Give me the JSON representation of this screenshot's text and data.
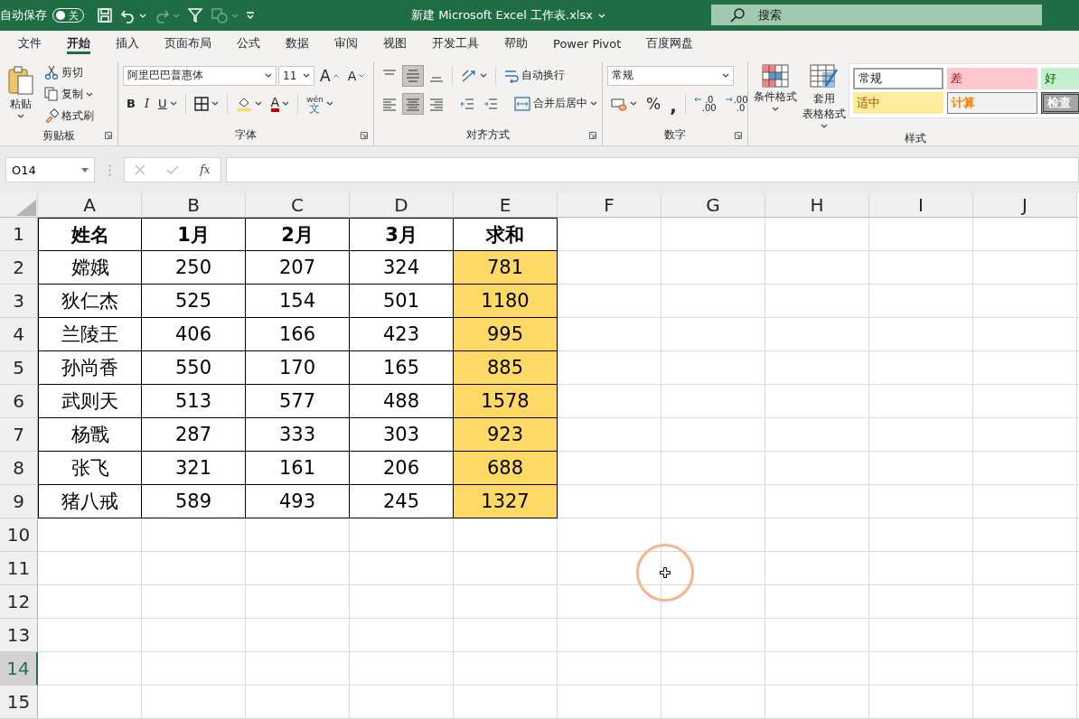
{
  "title_bar": {
    "autosave_label": "自动保存",
    "autosave_toggle": {
      "label": "关",
      "on": false
    },
    "quick_access": [
      {
        "kind": "save",
        "disabled": false
      },
      {
        "kind": "undo",
        "disabled": false
      },
      {
        "kind": "redo",
        "disabled": true
      },
      {
        "kind": "filter",
        "disabled": false
      },
      {
        "kind": "shapes",
        "disabled": true
      },
      {
        "kind": "customize",
        "disabled": false
      }
    ],
    "title": "新建 Microsoft Excel 工作表.xlsx",
    "search": {
      "placeholder": "搜索"
    }
  },
  "ribbon_tabs": [
    {
      "label": "文件",
      "selected": false
    },
    {
      "label": "开始",
      "selected": true
    },
    {
      "label": "插入",
      "selected": false
    },
    {
      "label": "页面布局",
      "selected": false
    },
    {
      "label": "公式",
      "selected": false
    },
    {
      "label": "数据",
      "selected": false
    },
    {
      "label": "审阅",
      "selected": false
    },
    {
      "label": "视图",
      "selected": false
    },
    {
      "label": "开发工具",
      "selected": false
    },
    {
      "label": "帮助",
      "selected": false
    },
    {
      "label": "Power Pivot",
      "selected": false
    },
    {
      "label": "百度网盘",
      "selected": false
    }
  ],
  "ribbon": {
    "clipboard": {
      "label": "剪贴板",
      "paste": "粘贴",
      "cut": "剪切",
      "copy": "复制",
      "format_painter": "格式刷"
    },
    "font": {
      "label": "字体",
      "font_name": "阿里巴巴普惠体",
      "font_size": "11",
      "grow": "A",
      "shrink": "A",
      "bold": "B",
      "italic": "I",
      "underline": "U",
      "font_color": "A",
      "phonetic": {
        "top": "wén",
        "bottom": "文"
      }
    },
    "alignment": {
      "label": "对齐方式",
      "vertical": [
        {
          "kind": "top",
          "selected": false
        },
        {
          "kind": "middle",
          "selected": true
        },
        {
          "kind": "bottom",
          "selected": false
        }
      ],
      "horizontal": [
        {
          "kind": "left",
          "selected": false
        },
        {
          "kind": "center",
          "selected": true
        },
        {
          "kind": "right",
          "selected": false
        }
      ],
      "wrap_text": "自动换行",
      "merge_center": "合并后居中"
    },
    "number": {
      "label": "数字",
      "format": "常规",
      "percent": "%",
      "comma": ",",
      "decimals": [
        {
          "top": ".0",
          "bottom": ".00"
        },
        {
          "top": ".00",
          "bottom": ".0"
        }
      ]
    },
    "styles": {
      "label": "样式",
      "conditional_format": "条件格式",
      "table_format": [
        "套用",
        "表格格式"
      ],
      "cell_styles": [
        {
          "label": "常规",
          "kind": "normal"
        },
        {
          "label": "差",
          "kind": "bad"
        },
        {
          "label": "好",
          "kind": "good"
        },
        {
          "label": "适中",
          "kind": "neutral"
        },
        {
          "label": "计算",
          "kind": "calculation"
        },
        {
          "label": "检查",
          "kind": "check"
        }
      ]
    }
  },
  "formula_bar": {
    "name_box": "O14",
    "function_label": "fx"
  },
  "sheet": {
    "columns": [
      {
        "label": "A",
        "selected": false
      },
      {
        "label": "B",
        "selected": false
      },
      {
        "label": "C",
        "selected": false
      },
      {
        "label": "D",
        "selected": false
      },
      {
        "label": "E",
        "selected": false
      },
      {
        "label": "F",
        "selected": false
      },
      {
        "label": "G",
        "selected": false
      },
      {
        "label": "H",
        "selected": false
      },
      {
        "label": "I",
        "selected": false
      },
      {
        "label": "J",
        "selected": false
      }
    ],
    "row_headers": [
      {
        "label": "1",
        "selected": false
      },
      {
        "label": "2",
        "selected": false
      },
      {
        "label": "3",
        "selected": false
      },
      {
        "label": "4",
        "selected": false
      },
      {
        "label": "5",
        "selected": false
      },
      {
        "label": "6",
        "selected": false
      },
      {
        "label": "7",
        "selected": false
      },
      {
        "label": "8",
        "selected": false
      },
      {
        "label": "9",
        "selected": false
      },
      {
        "label": "10",
        "selected": false
      },
      {
        "label": "11",
        "selected": false
      },
      {
        "label": "12",
        "selected": false
      },
      {
        "label": "13",
        "selected": false
      },
      {
        "label": "14",
        "selected": true
      },
      {
        "label": "15",
        "selected": false
      }
    ],
    "rows": [
      {
        "kind": "header",
        "cells": [
          {
            "text": "姓名",
            "highlighted": false
          },
          {
            "text": "1月",
            "highlighted": false
          },
          {
            "text": "2月",
            "highlighted": false
          },
          {
            "text": "3月",
            "highlighted": false
          },
          {
            "text": "求和",
            "highlighted": false
          }
        ]
      },
      {
        "kind": "data",
        "cells": [
          {
            "text": "嫦娥",
            "highlighted": false
          },
          {
            "text": "250",
            "highlighted": false
          },
          {
            "text": "207",
            "highlighted": false
          },
          {
            "text": "324",
            "highlighted": false
          },
          {
            "text": "781",
            "highlighted": true
          }
        ]
      },
      {
        "kind": "data",
        "cells": [
          {
            "text": "狄仁杰",
            "highlighted": false
          },
          {
            "text": "525",
            "highlighted": false
          },
          {
            "text": "154",
            "highlighted": false
          },
          {
            "text": "501",
            "highlighted": false
          },
          {
            "text": "1180",
            "highlighted": true
          }
        ]
      },
      {
        "kind": "data",
        "cells": [
          {
            "text": "兰陵王",
            "highlighted": false
          },
          {
            "text": "406",
            "highlighted": false
          },
          {
            "text": "166",
            "highlighted": false
          },
          {
            "text": "423",
            "highlighted": false
          },
          {
            "text": "995",
            "highlighted": true
          }
        ]
      },
      {
        "kind": "data",
        "cells": [
          {
            "text": "孙尚香",
            "highlighted": false
          },
          {
            "text": "550",
            "highlighted": false
          },
          {
            "text": "170",
            "highlighted": false
          },
          {
            "text": "165",
            "highlighted": false
          },
          {
            "text": "885",
            "highlighted": true
          }
        ]
      },
      {
        "kind": "data",
        "cells": [
          {
            "text": "武则天",
            "highlighted": false
          },
          {
            "text": "513",
            "highlighted": false
          },
          {
            "text": "577",
            "highlighted": false
          },
          {
            "text": "488",
            "highlighted": false
          },
          {
            "text": "1578",
            "highlighted": true
          }
        ]
      },
      {
        "kind": "data",
        "cells": [
          {
            "text": "杨戬",
            "highlighted": false
          },
          {
            "text": "287",
            "highlighted": false
          },
          {
            "text": "333",
            "highlighted": false
          },
          {
            "text": "303",
            "highlighted": false
          },
          {
            "text": "923",
            "highlighted": true
          }
        ]
      },
      {
        "kind": "data",
        "cells": [
          {
            "text": "张飞",
            "highlighted": false
          },
          {
            "text": "321",
            "highlighted": false
          },
          {
            "text": "161",
            "highlighted": false
          },
          {
            "text": "206",
            "highlighted": false
          },
          {
            "text": "688",
            "highlighted": true
          }
        ]
      },
      {
        "kind": "data",
        "cells": [
          {
            "text": "猪八戒",
            "highlighted": false
          },
          {
            "text": "589",
            "highlighted": false
          },
          {
            "text": "493",
            "highlighted": false
          },
          {
            "text": "245",
            "highlighted": false
          },
          {
            "text": "1327",
            "highlighted": true
          }
        ]
      }
    ]
  }
}
